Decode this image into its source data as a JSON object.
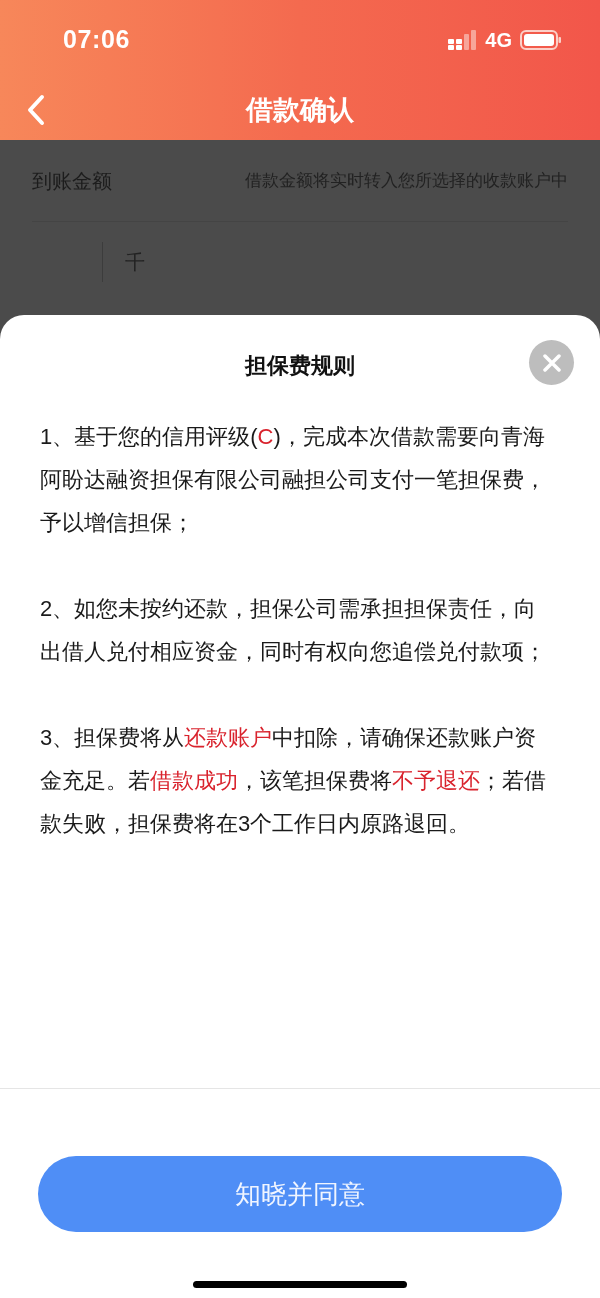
{
  "status_bar": {
    "time": "07:06",
    "network": "4G"
  },
  "nav": {
    "title": "借款确认"
  },
  "background": {
    "amount_label": "到账金额",
    "amount_hint": "借款金额将实时转入您所选择的收款账户中",
    "unit": "千"
  },
  "dialog": {
    "title": "担保费规则",
    "paragraphs": [
      [
        {
          "text": "1、基于您的信用评级(",
          "highlight": false
        },
        {
          "text": "C",
          "highlight": true
        },
        {
          "text": ")，完成本次借款需要向青海阿盼达融资担保有限公司融担公司支付一笔担保费，予以增信担保；",
          "highlight": false
        }
      ],
      [
        {
          "text": "2、如您未按约还款，担保公司需承担担保责任，向出借人兑付相应资金，同时有权向您追偿兑付款项；",
          "highlight": false
        }
      ],
      [
        {
          "text": "3、担保费将从",
          "highlight": false
        },
        {
          "text": "还款账户",
          "highlight": true
        },
        {
          "text": "中扣除，请确保还款账户资金充足。若",
          "highlight": false
        },
        {
          "text": "借款成功",
          "highlight": true
        },
        {
          "text": "，该笔担保费将",
          "highlight": false
        },
        {
          "text": "不予退还",
          "highlight": true
        },
        {
          "text": "；若借款失败，担保费将在3个工作日内原路退回。",
          "highlight": false
        }
      ]
    ],
    "confirm_button": "知晓并同意"
  }
}
